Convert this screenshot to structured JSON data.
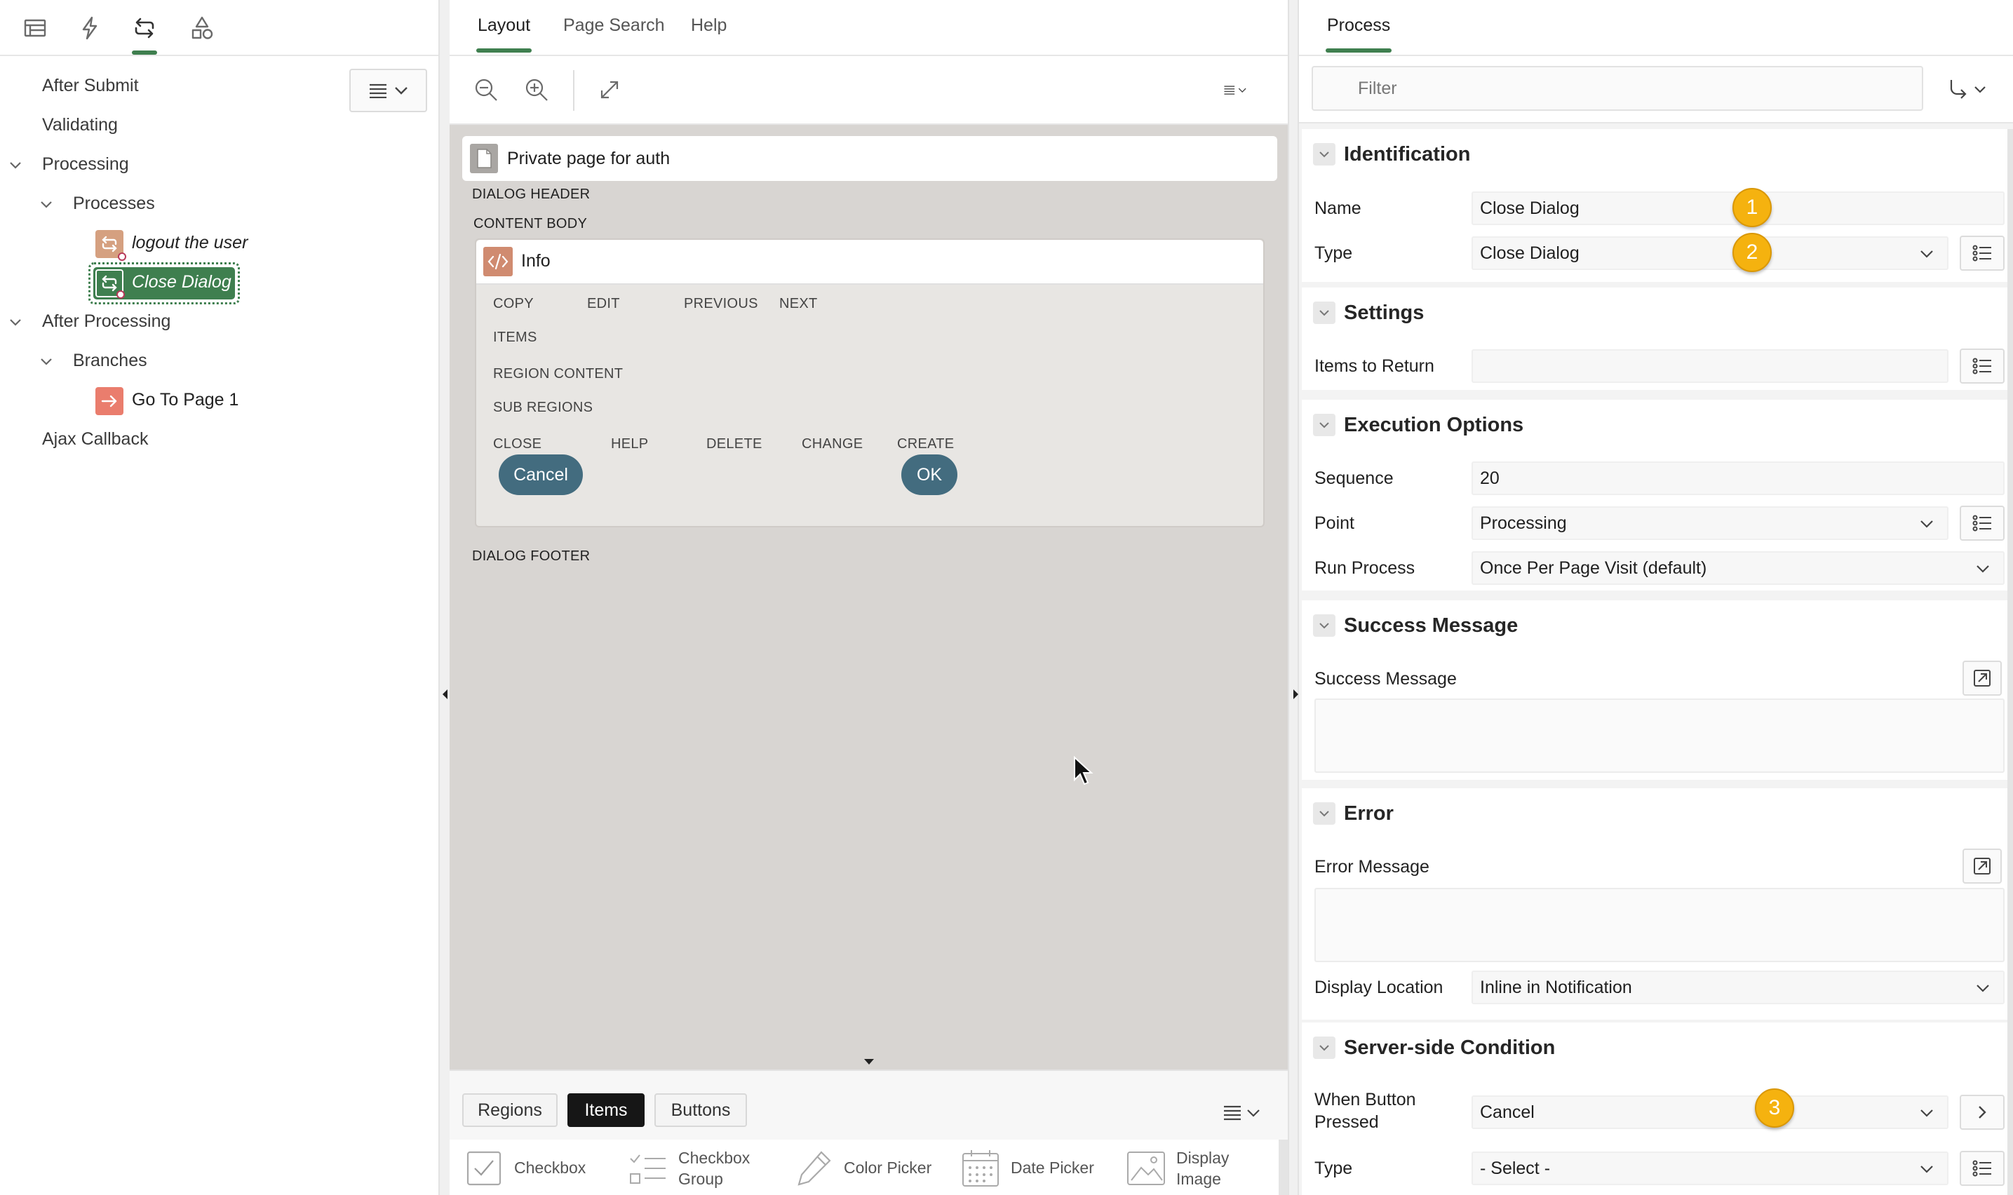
{
  "left_panel": {
    "tabs": [
      {
        "name": "rendering",
        "icon": "table-icon"
      },
      {
        "name": "dynamic-actions",
        "icon": "lightning-icon"
      },
      {
        "name": "processing",
        "icon": "loop-icon",
        "active": true
      },
      {
        "name": "shared-components",
        "icon": "shapes-icon"
      }
    ],
    "tree": {
      "after_submit": "After Submit",
      "validating": "Validating",
      "processing": "Processing",
      "processes": "Processes",
      "process_1": "logout the user",
      "process_2": "Close Dialog",
      "after_processing": "After Processing",
      "branches": "Branches",
      "branch_1": "Go To Page 1",
      "ajax_callback": "Ajax Callback"
    }
  },
  "center_panel": {
    "tabs": [
      "Layout",
      "Page Search",
      "Help"
    ],
    "active_tab": "Layout",
    "canvas": {
      "page_title": "Private page for auth",
      "dialog_header": "DIALOG HEADER",
      "content_body": "CONTENT BODY",
      "region_title": "Info",
      "positions_row1": [
        "COPY",
        "EDIT",
        "PREVIOUS",
        "NEXT"
      ],
      "items": "ITEMS",
      "region_content": "REGION CONTENT",
      "sub_regions": "SUB REGIONS",
      "positions_row2": [
        "CLOSE",
        "HELP",
        "DELETE",
        "CHANGE",
        "CREATE"
      ],
      "cancel_button": "Cancel",
      "ok_button": "OK",
      "dialog_footer": "DIALOG FOOTER"
    },
    "gallery": {
      "tabs": [
        "Regions",
        "Items",
        "Buttons"
      ],
      "active_tab": "Items",
      "items": [
        {
          "label": "Checkbox",
          "icon": "checkbox-icon"
        },
        {
          "label_line1": "Checkbox",
          "label_line2": "Group",
          "icon": "checkbox-group-icon"
        },
        {
          "label": "Color Picker",
          "icon": "color-picker-icon"
        },
        {
          "label": "Date Picker",
          "icon": "date-picker-icon"
        },
        {
          "label_line1": "Display",
          "label_line2": "Image",
          "icon": "display-image-icon"
        }
      ]
    }
  },
  "right_panel": {
    "tab": "Process",
    "filter_placeholder": "Filter",
    "sections": {
      "identification": {
        "title": "Identification",
        "name_label": "Name",
        "name_value": "Close Dialog",
        "type_label": "Type",
        "type_value": "Close Dialog"
      },
      "settings": {
        "title": "Settings",
        "items_label": "Items to Return",
        "items_value": ""
      },
      "execution": {
        "title": "Execution Options",
        "sequence_label": "Sequence",
        "sequence_value": "20",
        "point_label": "Point",
        "point_value": "Processing",
        "run_label": "Run Process",
        "run_value": "Once Per Page Visit (default)"
      },
      "success": {
        "title": "Success Message",
        "message_label": "Success Message"
      },
      "error": {
        "title": "Error",
        "message_label": "Error Message",
        "location_label": "Display Location",
        "location_value": "Inline in Notification"
      },
      "condition": {
        "title": "Server-side Condition",
        "button_label_line1": "When Button",
        "button_label_line2": "Pressed",
        "button_value": "Cancel",
        "type_label": "Type",
        "type_value": "- Select -"
      }
    },
    "badges": [
      "1",
      "2",
      "3"
    ]
  },
  "colors": {
    "accent_green": "#3f7f4f",
    "canvas_bg": "#d8d5d2",
    "button_teal": "#436c7f",
    "badge_yellow": "#f5b20f"
  }
}
